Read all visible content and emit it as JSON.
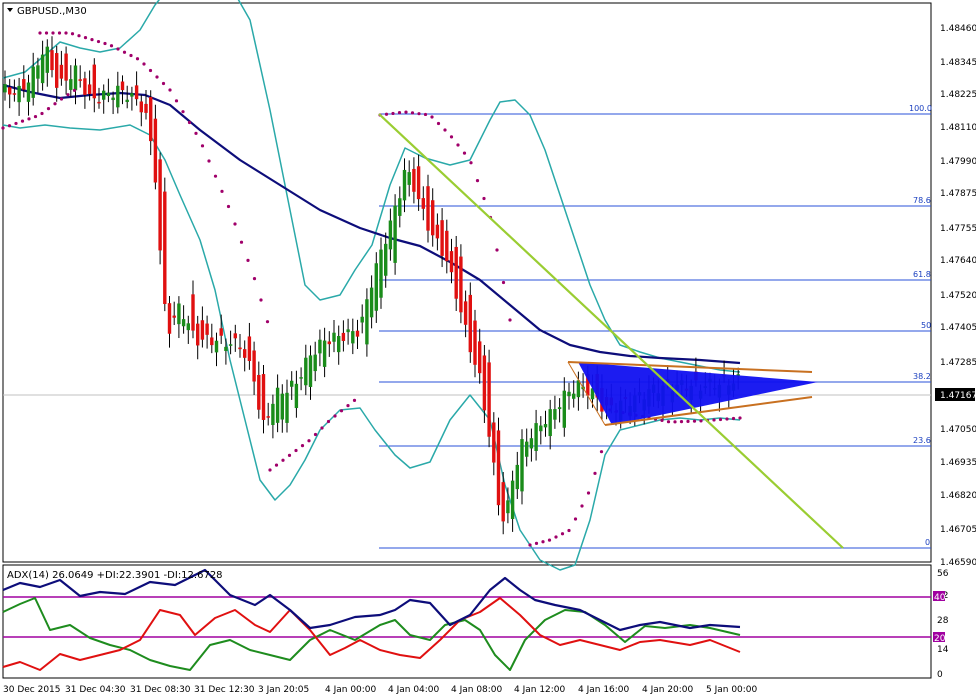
{
  "header": {
    "symbol_label": "GBPUSD.,M30",
    "indicator_label": "ADX(14) 26.0649 +DI:22.3901 -DI:12.6728"
  },
  "price_axis": {
    "labels": [
      "1.48460",
      "1.48345",
      "1.48225",
      "1.48110",
      "1.47990",
      "1.47875",
      "1.47755",
      "1.47640",
      "1.47520",
      "1.47405",
      "1.47285",
      "1.47050",
      "1.46935",
      "1.46820",
      "1.46705",
      "1.46590"
    ],
    "current_price": "1.47167"
  },
  "indicator_axis": {
    "labels": [
      "56",
      "42",
      "28",
      "14",
      "0"
    ],
    "level_high": "40",
    "level_low": "20"
  },
  "time_axis": {
    "labels": [
      "30 Dec 2015",
      "31 Dec 04:30",
      "31 Dec 08:30",
      "31 Dec 12:30",
      "3 Jan 20:05",
      "4 Jan 00:00",
      "4 Jan 04:00",
      "4 Jan 08:00",
      "4 Jan 12:00",
      "4 Jan 16:00",
      "4 Jan 20:00",
      "5 Jan 00:00"
    ]
  },
  "fibonacci": {
    "levels": [
      "100.0",
      "78.6",
      "61.8",
      "50",
      "38.2",
      "23.6",
      "0"
    ],
    "high": 1.4815,
    "low": 1.4662
  },
  "colors": {
    "bull": "#1a8c1a",
    "bear": "#e01010",
    "ma": "#0d0d7a",
    "bands": "#2aa9a9",
    "sar": "#a0006a",
    "fib": "#2a52d9",
    "trendline": "#9acd32",
    "triangle_fill": "#1010f0",
    "triangle_edge": "#c87020",
    "plus_di": "#1e8c1e",
    "minus_di": "#e01010",
    "adx": "#0d0d7a",
    "level": "#a000a0"
  },
  "chart_data": {
    "type": "line",
    "series": [
      {
        "name": "GBPUSD.,M30",
        "x": [
          "30 Dec 2015",
          "31 Dec 04:30",
          "31 Dec 08:30",
          "31 Dec 12:30",
          "3 Jan 20:05",
          "4 Jan 00:00",
          "4 Jan 04:00",
          "4 Jan 08:00",
          "4 Jan 12:00",
          "4 Jan 16:00",
          "4 Jan 20:00",
          "5 Jan 00:00"
        ],
        "values": [
          1.4822,
          1.4825,
          1.4742,
          1.4726,
          1.4731,
          1.4728,
          1.4797,
          1.4735,
          1.4692,
          1.4712,
          1.4716,
          1.4717
        ]
      }
    ],
    "ylim": [
      1.4659,
      1.4852
    ]
  }
}
